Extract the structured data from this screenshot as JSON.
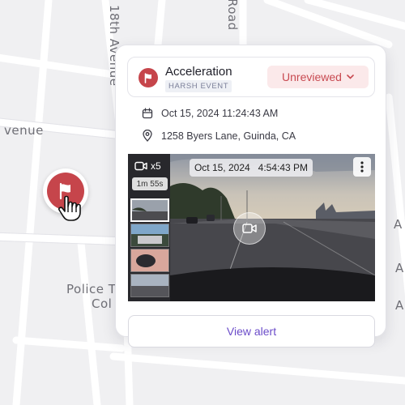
{
  "map": {
    "labels": {
      "avenue_18th": "18th Avenue",
      "road": "Road",
      "avenue_left": "venue",
      "police": "Police T",
      "col": "Col",
      "right_a": "A"
    }
  },
  "pin": {
    "icon": "flag-icon",
    "color": "#c6454b"
  },
  "event": {
    "title": "Acceleration",
    "subtitle": "HARSH EVENT",
    "status": "Unreviewed",
    "datetime": "Oct 15, 2024 11:24:43 AM",
    "location": "1258 Byers Lane, Guinda, CA"
  },
  "video": {
    "camera_count": "x5",
    "duration": "1m 55s",
    "timestamp_date": "Oct 15, 2024",
    "timestamp_time": "4:54:43 PM"
  },
  "actions": {
    "view_alert": "View alert"
  },
  "colors": {
    "accent": "#6b4cc9",
    "alert": "#c6454b",
    "status_bg": "#fbe9ea"
  }
}
